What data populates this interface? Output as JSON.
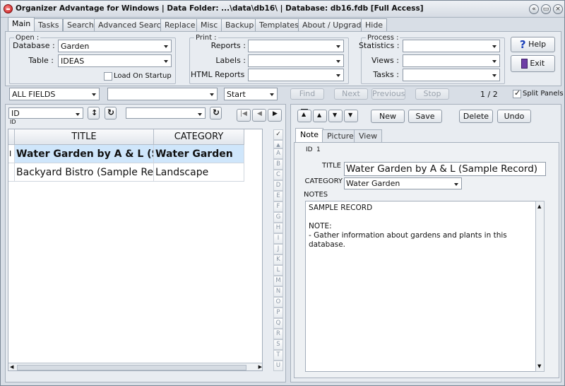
{
  "window": {
    "title": "Organizer Advantage for Windows | Data Folder: ...\\data\\db16\\ | Database: db16.fdb [Full Access]",
    "buttons": [
      "«",
      "▭",
      "×"
    ]
  },
  "main_tabs": [
    "Main",
    "Tasks",
    "Search",
    "Advanced Search",
    "Replace",
    "Misc",
    "Backup",
    "Templates",
    "About / Upgrade",
    "Hide"
  ],
  "open": {
    "legend": "Open :",
    "database_label": "Database :",
    "database_value": "Garden",
    "table_label": "Table :",
    "table_value": "IDEAS",
    "load_on_startup": "Load On Startup"
  },
  "print": {
    "legend": "Print :",
    "reports_label": "Reports :",
    "labels_label": "Labels :",
    "html_reports_label": "HTML Reports :"
  },
  "process": {
    "legend": "Process :",
    "statistics_label": "Statistics :",
    "views_label": "Views :",
    "tasks_label": "Tasks :"
  },
  "help_label": "Help",
  "exit_label": "Exit",
  "search": {
    "field": "ALL FIELDS",
    "value": "",
    "mode": "Start",
    "find": "Find",
    "next": "Next",
    "previous": "Previous",
    "stop": "Stop",
    "counter": "1 / 2",
    "split_panels": "Split Panels"
  },
  "left": {
    "sort_field": "ID",
    "sort_caption": "ID",
    "filter_value": "",
    "columns": [
      "TITLE",
      "CATEGORY"
    ],
    "row_indicator": "I",
    "rows": [
      {
        "title": "Water Garden by A & L (Sample Record)",
        "category": "Water Garden"
      },
      {
        "title": "Backyard Bistro (Sample Record)",
        "category": "Landscape"
      }
    ],
    "alphabet": [
      "A",
      "B",
      "C",
      "D",
      "E",
      "F",
      "G",
      "H",
      "I",
      "J",
      "K",
      "L",
      "M",
      "N",
      "O",
      "P",
      "Q",
      "R",
      "S",
      "T",
      "U"
    ]
  },
  "right": {
    "new": "New",
    "save": "Save",
    "delete": "Delete",
    "undo": "Undo",
    "tabs": [
      "Note",
      "Picture",
      "View"
    ],
    "id_label": "ID",
    "id_value": "1",
    "title_label": "TITLE",
    "title_value": "Water Garden by A & L (Sample Record)",
    "category_label": "CATEGORY",
    "category_value": "Water Garden",
    "notes_label": "NOTES",
    "notes_value": "SAMPLE RECORD\n\nNOTE:\n- Gather information about gardens and plants in this database."
  }
}
